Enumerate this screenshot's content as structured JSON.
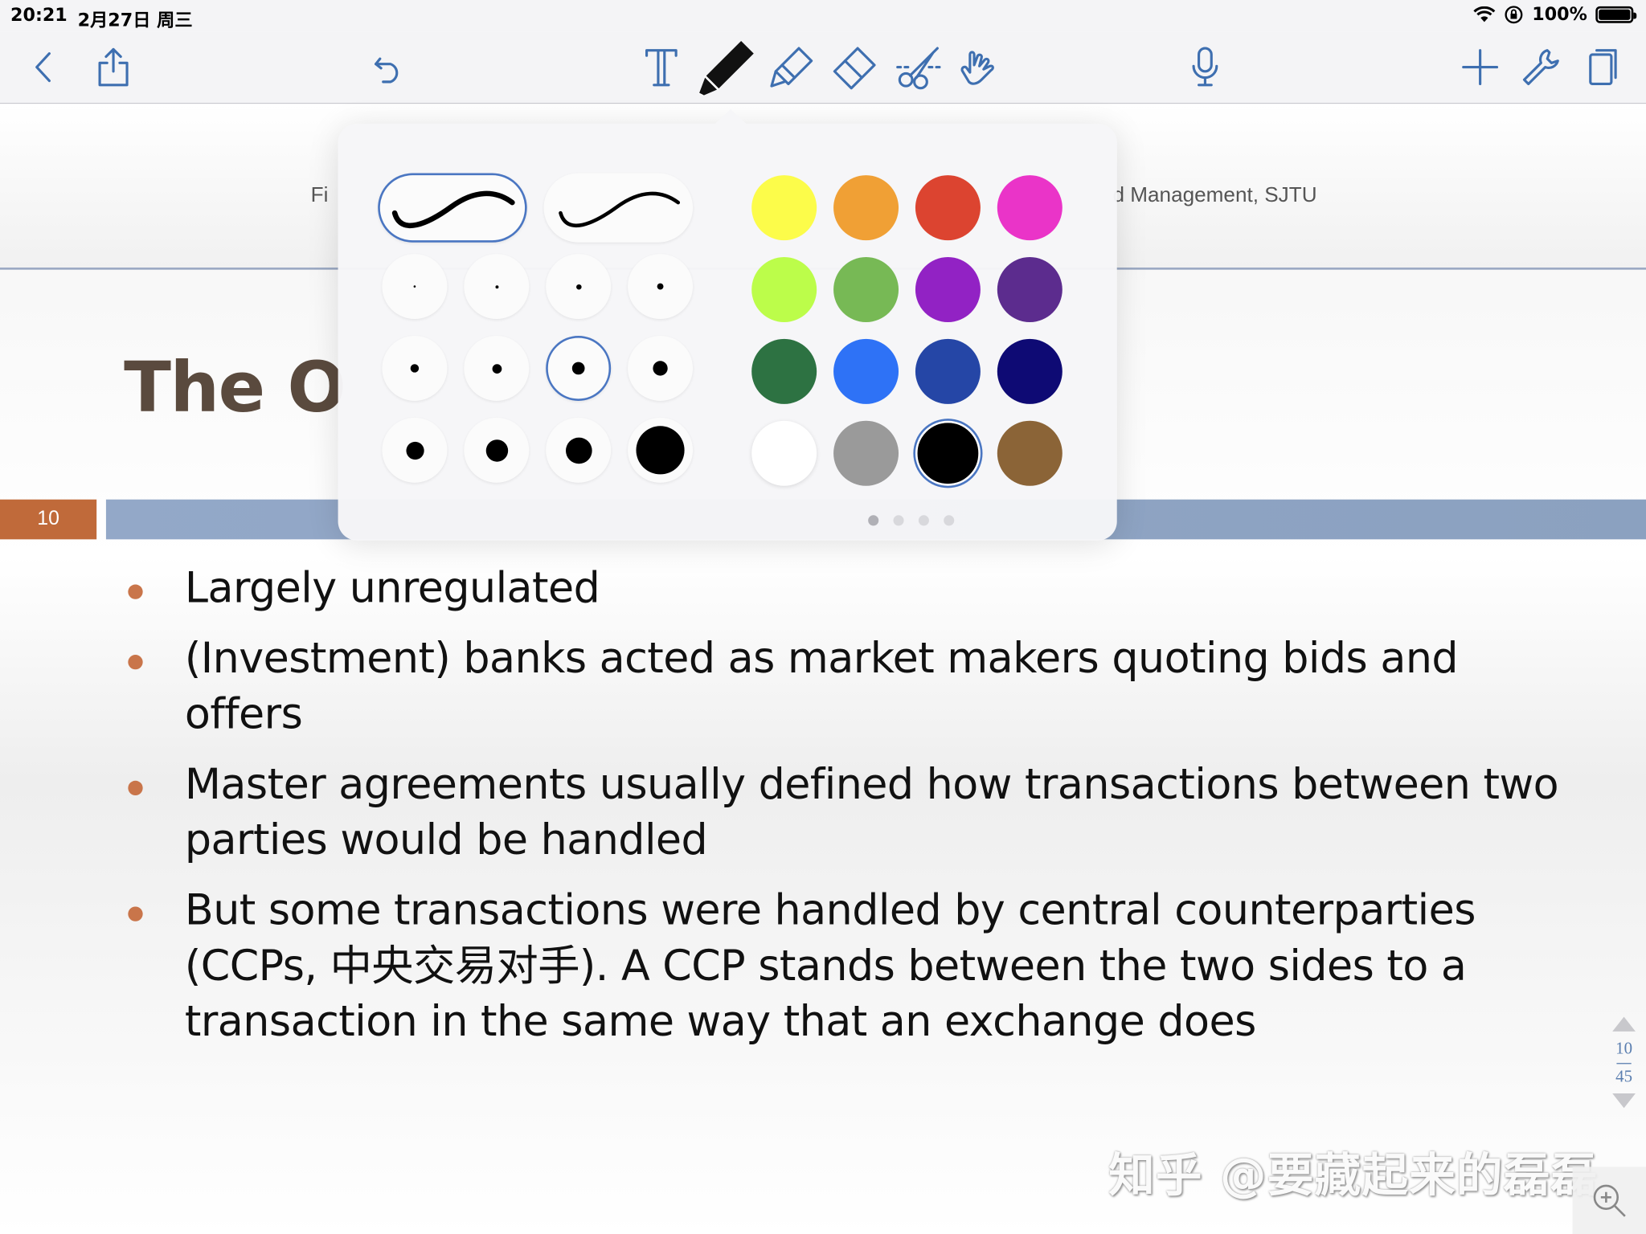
{
  "status_bar": {
    "time": "20:21",
    "date": "2月27日 周三",
    "battery": "100%",
    "icons": [
      "wifi-icon",
      "orientation-lock-icon",
      "battery-icon"
    ]
  },
  "toolbar": {
    "left": [
      "back-icon",
      "share-icon",
      "undo-icon"
    ],
    "tools": [
      "text-tool-icon",
      "pen-tool-icon",
      "highlighter-tool-icon",
      "eraser-tool-icon",
      "lasso-scissors-icon",
      "hand-pointer-icon"
    ],
    "selected_tool": "pen",
    "center": [
      "microphone-icon"
    ],
    "right": [
      "add-icon",
      "wrench-icon",
      "pages-icon"
    ]
  },
  "slide": {
    "course_left": "Fi",
    "course_right": "d Management, SJTU",
    "title_visible": "The O",
    "number": "10",
    "bullets": [
      "Largely unregulated",
      "(Investment) banks acted as market makers quoting bids and offers",
      "Master agreements usually defined how transactions between two parties would be handled",
      "But some transactions were handled by central counterparties (CCPs, 中央交易对手). A CCP stands between the two sides to a transaction in the same way that an exchange does"
    ]
  },
  "pager": {
    "current": "10",
    "total": "45"
  },
  "watermark": "知乎 @要藏起来的磊磊",
  "pen_popover": {
    "stroke_styles": [
      "fountain-pen-stroke",
      "ball-pen-stroke"
    ],
    "selected_stroke": 0,
    "sizes": [
      0.04,
      0.07,
      0.1,
      0.13,
      0.17,
      0.2,
      0.25,
      0.3,
      0.38,
      0.46,
      0.55,
      1.0
    ],
    "selected_size": 6,
    "colors": [
      "#fcfc4a",
      "#f0a035",
      "#dc4430",
      "#ea34c8",
      "#bcfd4a",
      "#77b955",
      "#9222c4",
      "#5c2c8e",
      "#2d7242",
      "#2e72f6",
      "#2546a6",
      "#0e0a74",
      "#ffffff",
      "#9a9a9a",
      "#000000",
      "#8b6437"
    ],
    "selected_color": 14,
    "page_count": 4,
    "current_page": 0
  }
}
